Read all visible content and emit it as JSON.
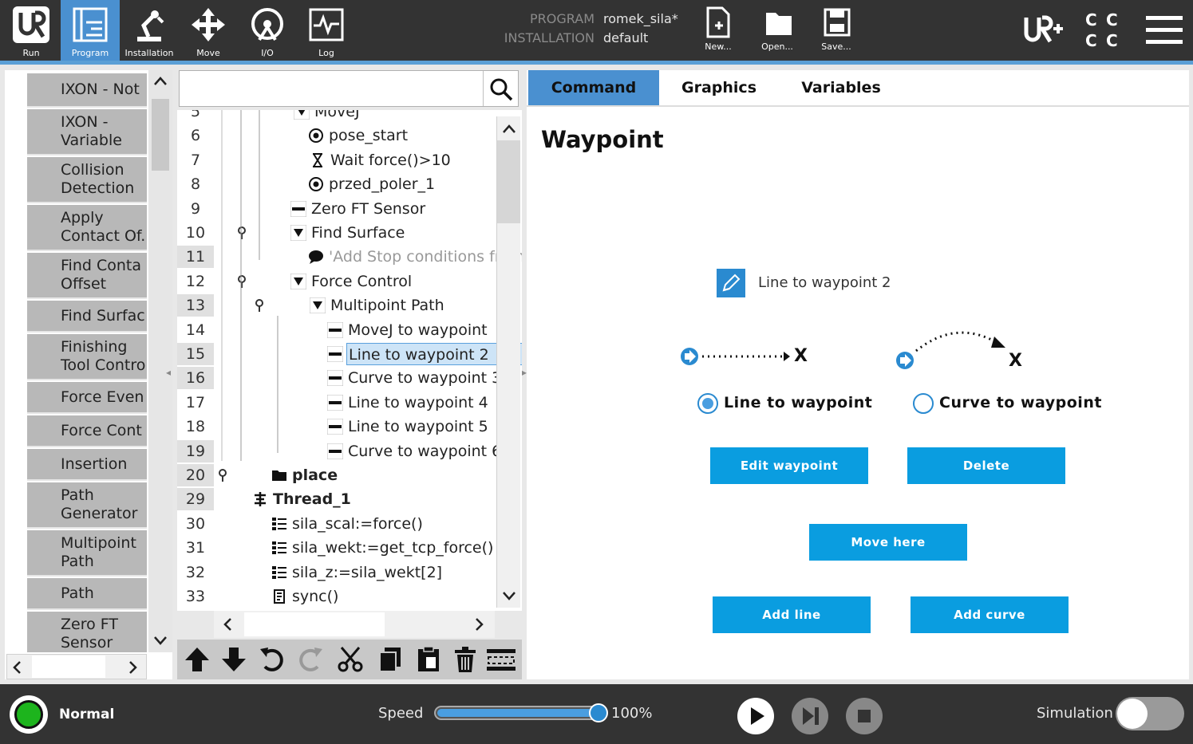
{
  "topbar": {
    "nav": [
      {
        "label": "Run",
        "icon": "ur-logo-icon"
      },
      {
        "label": "Program",
        "icon": "program-icon"
      },
      {
        "label": "Installation",
        "icon": "installation-icon"
      },
      {
        "label": "Move",
        "icon": "move-icon"
      },
      {
        "label": "I/O",
        "icon": "io-icon"
      },
      {
        "label": "Log",
        "icon": "log-icon"
      }
    ],
    "program_label": "PROGRAM",
    "program_value": "romek_sila*",
    "installation_label": "INSTALLATION",
    "installation_value": "default",
    "file_buttons": [
      {
        "label": "New...",
        "icon": "new-file-icon"
      },
      {
        "label": "Open...",
        "icon": "open-folder-icon"
      },
      {
        "label": "Save...",
        "icon": "save-icon"
      }
    ]
  },
  "left_panel": {
    "items": [
      "IXON - Not",
      "IXON -\nVariable",
      "Collision\nDetection",
      "Apply\nContact Of.",
      "Find Conta\nOffset",
      "Find Surfac",
      "Finishing\nTool Contro",
      "Force Even",
      "Force Cont",
      "Insertion",
      "Path\nGenerator",
      "Multipoint\nPath",
      "Path",
      "Zero FT\nSensor"
    ]
  },
  "tree": {
    "search_placeholder": "",
    "rows": [
      {
        "line": "5",
        "text": "MoveJ",
        "icon": "movej-icon"
      },
      {
        "line": "6",
        "text": "pose_start",
        "icon": "waypoint-icon"
      },
      {
        "line": "7",
        "text": "Wait force()>10",
        "icon": "hourglass-icon"
      },
      {
        "line": "8",
        "text": "przed_poler_1",
        "icon": "waypoint-icon"
      },
      {
        "line": "9",
        "text": "Zero FT Sensor",
        "icon": "dash-icon"
      },
      {
        "line": "10",
        "text": "Find Surface",
        "icon": "collapse-arrow-icon"
      },
      {
        "line": "11",
        "text": "'Add Stop conditions from t",
        "icon": "comment-icon"
      },
      {
        "line": "12",
        "text": "Force Control",
        "icon": "collapse-arrow-icon"
      },
      {
        "line": "13",
        "text": "Multipoint Path",
        "icon": "collapse-arrow-icon"
      },
      {
        "line": "14",
        "text": "MoveJ to waypoint",
        "icon": "dash-icon"
      },
      {
        "line": "15",
        "text": "Line to waypoint 2",
        "icon": "dash-icon"
      },
      {
        "line": "16",
        "text": "Curve to waypoint 3",
        "icon": "dash-icon"
      },
      {
        "line": "17",
        "text": "Line to waypoint 4",
        "icon": "dash-icon"
      },
      {
        "line": "18",
        "text": "Line to waypoint 5",
        "icon": "dash-icon"
      },
      {
        "line": "19",
        "text": "Curve to waypoint 6",
        "icon": "dash-icon"
      },
      {
        "line": "20",
        "text": "place",
        "icon": "folder-icon"
      },
      {
        "line": "29",
        "text": "Thread_1",
        "icon": "thread-icon"
      },
      {
        "line": "30",
        "text": "sila_scal:=force()",
        "icon": "assignment-icon"
      },
      {
        "line": "31",
        "text": "sila_wekt:=get_tcp_force()",
        "icon": "assignment-icon"
      },
      {
        "line": "32",
        "text": "sila_z:=sila_wekt[2]",
        "icon": "assignment-icon"
      },
      {
        "line": "33",
        "text": "sync()",
        "icon": "script-icon"
      }
    ],
    "toolbar_icons": [
      "move-up-icon",
      "move-down-icon",
      "undo-icon",
      "redo-icon",
      "cut-icon",
      "copy-icon",
      "paste-icon",
      "delete-icon",
      "suppress-icon"
    ]
  },
  "right_panel": {
    "tabs": [
      "Command",
      "Graphics",
      "Variables"
    ],
    "active_tab": "Command",
    "title": "Waypoint",
    "waypoint_name": "Line to waypoint 2",
    "x_label": "X",
    "radio_line": "Line to waypoint",
    "radio_curve": "Curve to waypoint",
    "selected_motion": "line",
    "buttons": {
      "edit": "Edit waypoint",
      "delete": "Delete",
      "move_here": "Move here",
      "add_line": "Add line",
      "add_curve": "Add curve"
    },
    "button_color": "#0a9de0"
  },
  "bottombar": {
    "status": "Normal",
    "status_color": "#1db41d",
    "speed_label": "Speed",
    "speed_value": "100%",
    "speed_fraction": 1.0,
    "simulation_label": "Simulation",
    "simulation_on": false
  }
}
